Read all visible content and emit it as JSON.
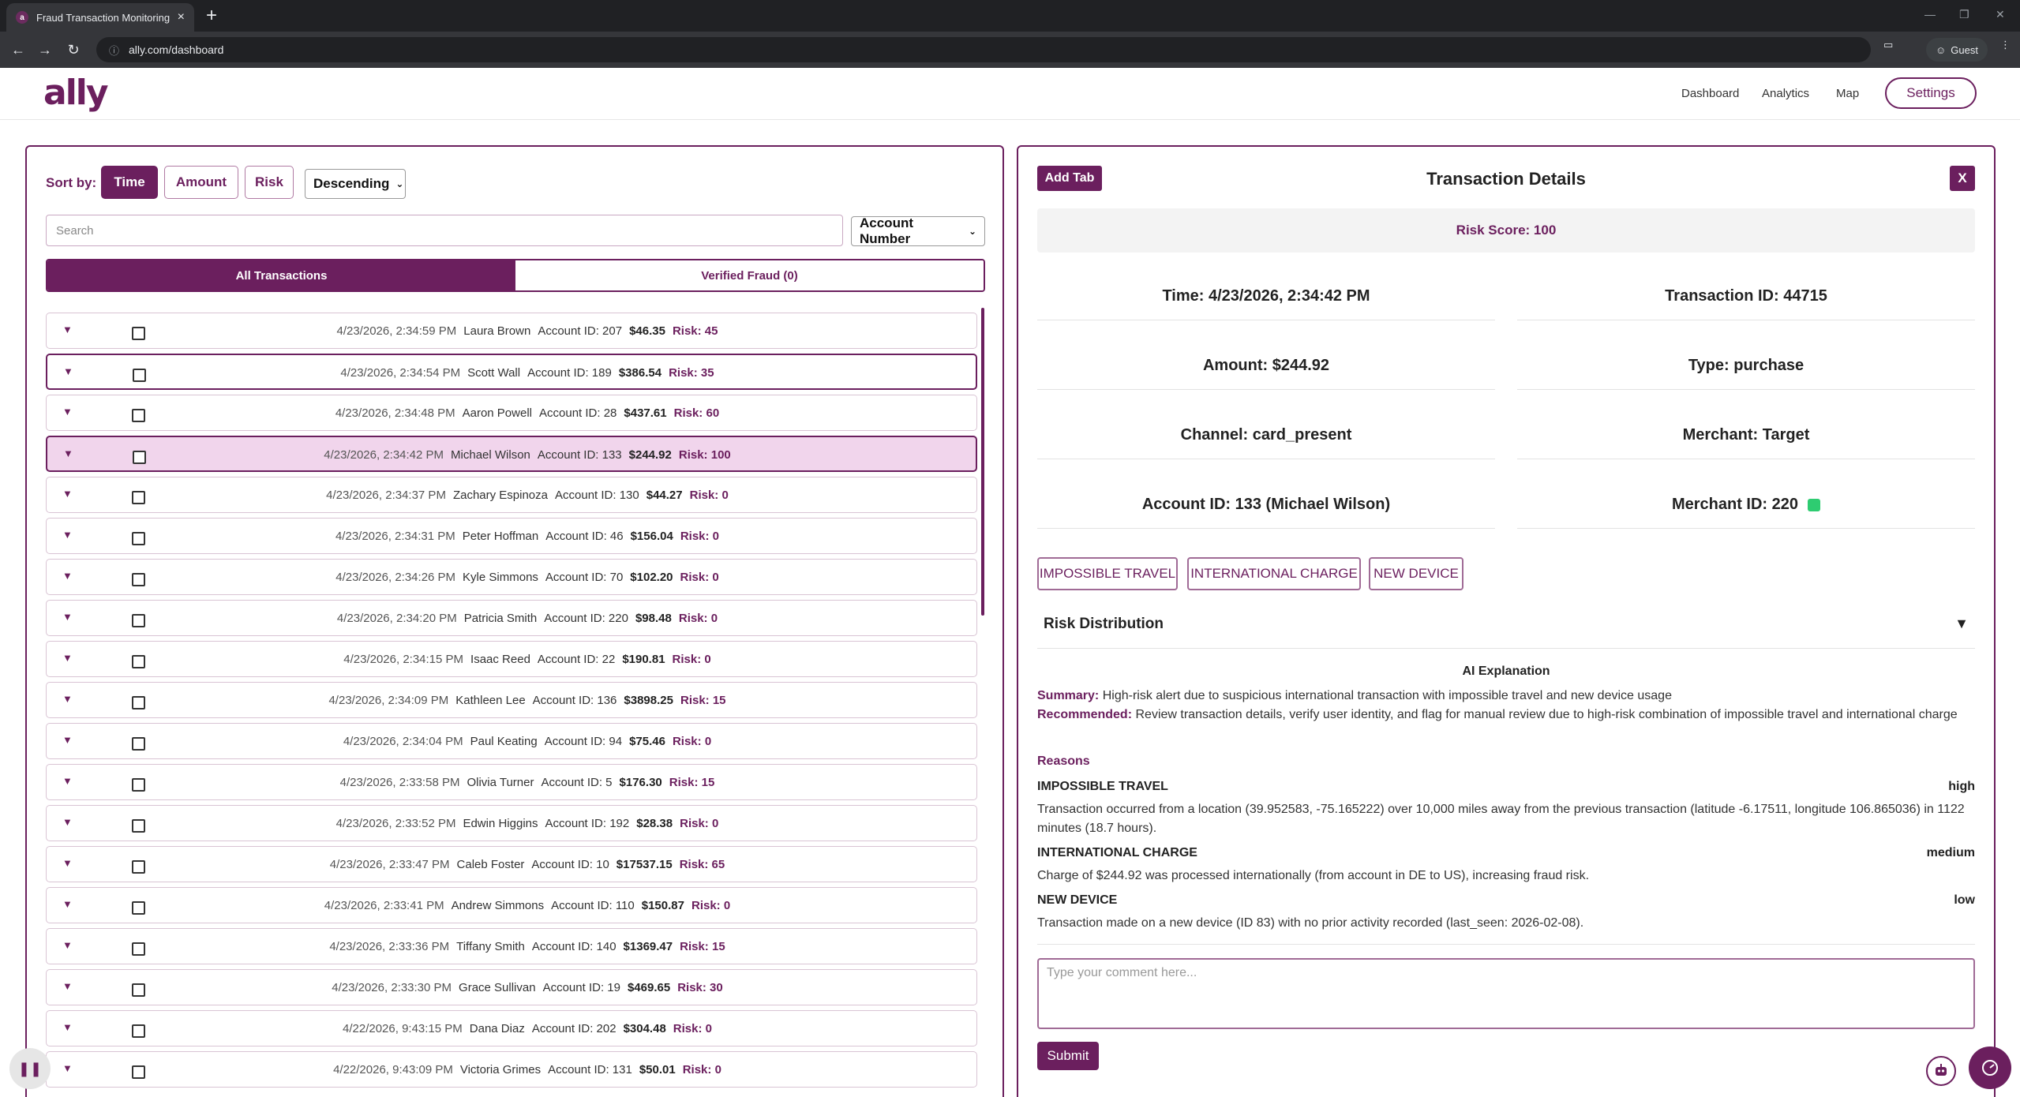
{
  "browser": {
    "tab_title": "Fraud Transaction Monitoring D",
    "url": "ally.com/dashboard",
    "guest_label": "Guest"
  },
  "header": {
    "logo": "ally",
    "nav": [
      "Dashboard",
      "Analytics",
      "Map"
    ],
    "settings_label": "Settings"
  },
  "left": {
    "sort_label": "Sort by:",
    "sort_buttons": [
      "Time",
      "Amount",
      "Risk"
    ],
    "active_sort": "Time",
    "order_select": "Descending",
    "search_placeholder": "Search",
    "filter_select": "Account Number",
    "tabs": [
      "All Transactions",
      "Verified Fraud (0)"
    ],
    "transactions": [
      {
        "time": "4/23/2026, 2:34:59 PM",
        "name": "Laura Brown",
        "account": "Account ID: 207",
        "amount": "$46.35",
        "risk": "Risk: 45"
      },
      {
        "time": "4/23/2026, 2:34:54 PM",
        "name": "Scott Wall",
        "account": "Account ID: 189",
        "amount": "$386.54",
        "risk": "Risk: 35"
      },
      {
        "time": "4/23/2026, 2:34:48 PM",
        "name": "Aaron Powell",
        "account": "Account ID: 28",
        "amount": "$437.61",
        "risk": "Risk: 60"
      },
      {
        "time": "4/23/2026, 2:34:42 PM",
        "name": "Michael Wilson",
        "account": "Account ID: 133",
        "amount": "$244.92",
        "risk": "Risk: 100"
      },
      {
        "time": "4/23/2026, 2:34:37 PM",
        "name": "Zachary Espinoza",
        "account": "Account ID: 130",
        "amount": "$44.27",
        "risk": "Risk: 0"
      },
      {
        "time": "4/23/2026, 2:34:31 PM",
        "name": "Peter Hoffman",
        "account": "Account ID: 46",
        "amount": "$156.04",
        "risk": "Risk: 0"
      },
      {
        "time": "4/23/2026, 2:34:26 PM",
        "name": "Kyle Simmons",
        "account": "Account ID: 70",
        "amount": "$102.20",
        "risk": "Risk: 0"
      },
      {
        "time": "4/23/2026, 2:34:20 PM",
        "name": "Patricia Smith",
        "account": "Account ID: 220",
        "amount": "$98.48",
        "risk": "Risk: 0"
      },
      {
        "time": "4/23/2026, 2:34:15 PM",
        "name": "Isaac Reed",
        "account": "Account ID: 22",
        "amount": "$190.81",
        "risk": "Risk: 0"
      },
      {
        "time": "4/23/2026, 2:34:09 PM",
        "name": "Kathleen Lee",
        "account": "Account ID: 136",
        "amount": "$3898.25",
        "risk": "Risk: 15"
      },
      {
        "time": "4/23/2026, 2:34:04 PM",
        "name": "Paul Keating",
        "account": "Account ID: 94",
        "amount": "$75.46",
        "risk": "Risk: 0"
      },
      {
        "time": "4/23/2026, 2:33:58 PM",
        "name": "Olivia Turner",
        "account": "Account ID: 5",
        "amount": "$176.30",
        "risk": "Risk: 15"
      },
      {
        "time": "4/23/2026, 2:33:52 PM",
        "name": "Edwin Higgins",
        "account": "Account ID: 192",
        "amount": "$28.38",
        "risk": "Risk: 0"
      },
      {
        "time": "4/23/2026, 2:33:47 PM",
        "name": "Caleb Foster",
        "account": "Account ID: 10",
        "amount": "$17537.15",
        "risk": "Risk: 65"
      },
      {
        "time": "4/23/2026, 2:33:41 PM",
        "name": "Andrew Simmons",
        "account": "Account ID: 110",
        "amount": "$150.87",
        "risk": "Risk: 0"
      },
      {
        "time": "4/23/2026, 2:33:36 PM",
        "name": "Tiffany Smith",
        "account": "Account ID: 140",
        "amount": "$1369.47",
        "risk": "Risk: 15"
      },
      {
        "time": "4/23/2026, 2:33:30 PM",
        "name": "Grace Sullivan",
        "account": "Account ID: 19",
        "amount": "$469.65",
        "risk": "Risk: 30"
      },
      {
        "time": "4/22/2026, 9:43:15 PM",
        "name": "Dana Diaz",
        "account": "Account ID: 202",
        "amount": "$304.48",
        "risk": "Risk: 0"
      },
      {
        "time": "4/22/2026, 9:43:09 PM",
        "name": "Victoria Grimes",
        "account": "Account ID: 131",
        "amount": "$50.01",
        "risk": "Risk: 0"
      }
    ]
  },
  "right": {
    "add_tab_label": "Add Tab",
    "title": "Transaction Details",
    "close_label": "X",
    "risk_score": "Risk Score: 100",
    "details": {
      "time": "Time: 4/23/2026, 2:34:42 PM",
      "transaction_id": "Transaction ID: 44715",
      "amount": "Amount: $244.92",
      "type": "Type: purchase",
      "channel": "Channel: card_present",
      "merchant": "Merchant: Target",
      "account": "Account ID: 133 (Michael Wilson)",
      "merchant_id": "Merchant ID: 220"
    },
    "merchant_status_color": "#2ecc71",
    "tags": [
      "IMPOSSIBLE TRAVEL",
      "INTERNATIONAL CHARGE",
      "NEW DEVICE"
    ],
    "risk_distribution_label": "Risk Distribution",
    "ai": {
      "title": "AI Explanation",
      "summary_key": "Summary:",
      "summary": "High-risk alert due to suspicious international transaction with impossible travel and new device usage",
      "recommended_key": "Recommended:",
      "recommended": "Review transaction details, verify user identity, and flag for manual review due to high-risk combination of impossible travel and international charge",
      "reasons_heading": "Reasons",
      "reasons": [
        {
          "title": "IMPOSSIBLE TRAVEL",
          "level": "high",
          "desc": "Transaction occurred from a location (39.952583, -75.165222) over 10,000 miles away from the previous transaction (latitude -6.17511, longitude 106.865036) in 1122 minutes (18.7 hours)."
        },
        {
          "title": "INTERNATIONAL CHARGE",
          "level": "medium",
          "desc": "Charge of $244.92 was processed internationally (from account in DE to US), increasing fraud risk."
        },
        {
          "title": "NEW DEVICE",
          "level": "low",
          "desc": "Transaction made on a new device (ID 83) with no prior activity recorded (last_seen: 2026-02-08)."
        }
      ]
    },
    "comment_placeholder": "Type your comment here...",
    "submit_label": "Submit"
  },
  "colors": {
    "brand": "#6b1f5e",
    "selected_row": "#f1d5ec"
  }
}
